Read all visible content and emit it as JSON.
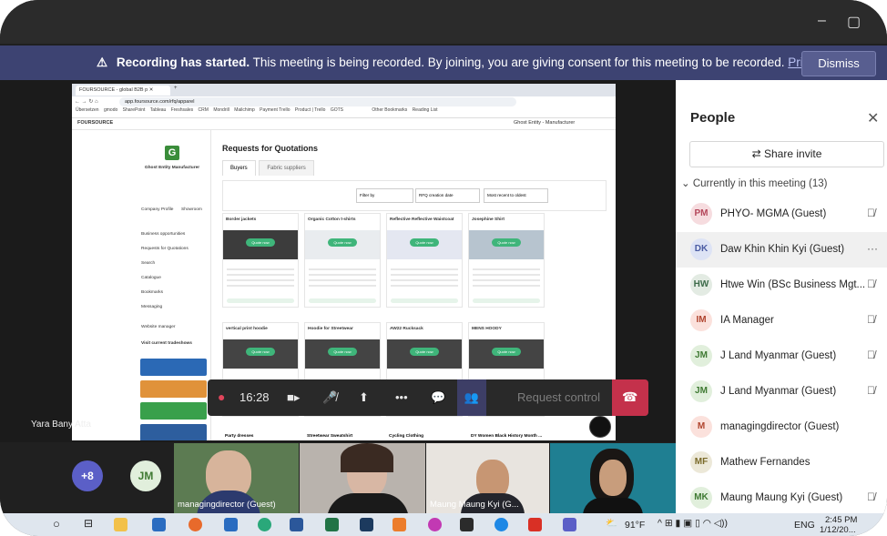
{
  "banner": {
    "title": "Recording has started.",
    "message": " This meeting is being recorded. By joining, you are giving consent for this meeting to be recorded. ",
    "link": "Privacy policy",
    "dismiss": "Dismiss"
  },
  "shared_screen": {
    "browser_tab": "FOURSOURCE - global B2B p",
    "url": "app.foursource.com/rfq/apparel",
    "bookmarks": [
      "Übersetzen",
      "gmodo",
      "SharePoint",
      "Tableau",
      "Freshsales",
      "CRM",
      "Mondrill",
      "Mailchimp",
      "Payment Trello",
      "Product | Trello",
      "GOTS",
      "Other Bookmarks",
      "Reading List"
    ],
    "brand": "FOURSOURCE",
    "account": "Ghost Entity - Manufacturer",
    "sidebar": {
      "company": "Ghost Entity Manufacturer",
      "items": [
        "Company Profile",
        "Showroom",
        "Business opportunities",
        "Requests for Quotations",
        "Search",
        "Catalogue",
        "Bookmarks",
        "Messaging",
        "Website manager",
        "Visit current tradeshows"
      ]
    },
    "page_title": "Requests for Quotations",
    "tabs": [
      "Buyers",
      "Fabric suppliers"
    ],
    "filters": {
      "filter_by": "Filter by",
      "sort_by": "RFQ creation date",
      "order": "Most recent to oldest"
    },
    "quote_label": "Quote now",
    "cards_row1": [
      "Border jackets",
      "Organic Cotton t-shirts",
      "Reflective Reflective Waistcoat",
      "Josephine Shirt"
    ],
    "cards_row2": [
      "vertical print hoodie",
      "Hoodie for Streetwear",
      "AW22 Rucksack",
      "MENS HOODY"
    ],
    "cards_row3": [
      "Party dresses",
      "Streetwear Sweatshirt",
      "Cycling Clothing",
      "DY Women Black History Month ..."
    ]
  },
  "meeting_controls": {
    "timer": "16:28",
    "request_control": "Request control"
  },
  "presenter_name": "Yara Bany Atta",
  "people": {
    "title": "People",
    "share_invite": "Share invite",
    "section": "Currently in this meeting (13)",
    "participants": [
      {
        "initials": "PM",
        "name": "PHYO- MGMA (Guest)",
        "color": "#f6dcdf",
        "fg": "#b4465a"
      },
      {
        "initials": "DK",
        "name": "Daw Khin Khin Kyi (Guest)",
        "color": "#dde3f5",
        "fg": "#4a5ba3"
      },
      {
        "initials": "HW",
        "name": "Htwe Win (BSc Business Mgt...",
        "color": "#e3ebe3",
        "fg": "#3d6b4a"
      },
      {
        "initials": "IM",
        "name": "IA Manager",
        "color": "#fbe1dc",
        "fg": "#b0442e"
      },
      {
        "initials": "JM",
        "name": "J Land Myanmar (Guest)",
        "color": "#e1efdc",
        "fg": "#3f7a33"
      },
      {
        "initials": "JM",
        "name": "J Land Myanmar (Guest)",
        "color": "#e1efdc",
        "fg": "#3f7a33"
      },
      {
        "initials": "M",
        "name": "managingdirector (Guest)",
        "color": "#fbe1dc",
        "fg": "#b0442e"
      },
      {
        "initials": "MF",
        "name": "Mathew Fernandes",
        "color": "#ece8d8",
        "fg": "#7a6a2a"
      },
      {
        "initials": "MK",
        "name": "Maung Maung Kyi (Guest)",
        "color": "#e1efdc",
        "fg": "#3f7a33"
      }
    ]
  },
  "video_strip": {
    "overflow": "+8",
    "jm": "JM",
    "tile1": "managingdirector (Guest)",
    "tile3": "Maung Maung Kyi (G..."
  },
  "taskbar": {
    "weather": "91°F",
    "lang": "ENG",
    "time": "2:45 PM",
    "date": "1/12/20..."
  },
  "colors": {
    "banner": "#3d4372",
    "hangup": "#c4314b",
    "quote": "#3fb57a"
  }
}
